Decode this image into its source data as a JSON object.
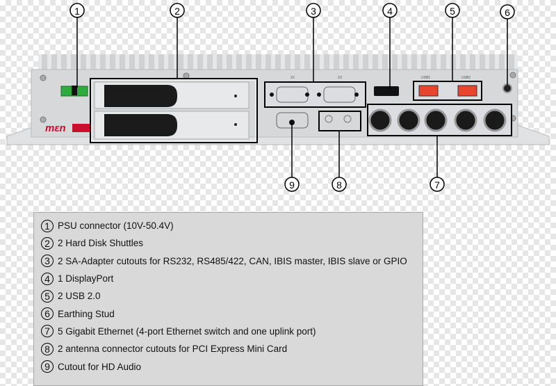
{
  "callouts": [
    {
      "num": "1",
      "label": "PSU connector (10V-50.4V)"
    },
    {
      "num": "2",
      "label": "2 Hard Disk Shuttles"
    },
    {
      "num": "3",
      "label": "2 SA-Adapter cutouts for RS232, RS485/422, CAN, IBIS master, IBIS slave or GPIO"
    },
    {
      "num": "4",
      "label": "1 DisplayPort"
    },
    {
      "num": "5",
      "label": "2 USB 2.0"
    },
    {
      "num": "6",
      "label": "Earthing Stud"
    },
    {
      "num": "7",
      "label": "5 Gigabit Ethernet (4-port Ethernet switch and one uplink port)"
    },
    {
      "num": "8",
      "label": "2 antenna connector cutouts for PCI Express Mini Card"
    },
    {
      "num": "9",
      "label": "Cutout for HD Audio"
    }
  ],
  "device": {
    "brand": "men",
    "labels": {
      "x1": "X1",
      "x2": "X2",
      "usb1": "USB1",
      "usb2": "USB2"
    }
  },
  "colors": {
    "brand_red": "#c8102e",
    "psu_green": "#2faa3f",
    "usb_red": "#e8452e",
    "panel": "#d6d8da"
  }
}
